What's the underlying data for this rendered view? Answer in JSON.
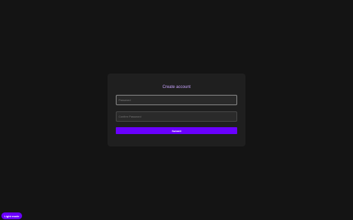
{
  "form": {
    "title": "Create account",
    "password_placeholder": "Password",
    "confirm_placeholder": "Confirm Password",
    "submit_label": "Submit"
  },
  "theme_toggle": {
    "label": "Light mode"
  },
  "colors": {
    "background": "#141414",
    "card": "#1f1f1f",
    "accent": "#6a00ff",
    "title_text": "#c9a4ff"
  }
}
